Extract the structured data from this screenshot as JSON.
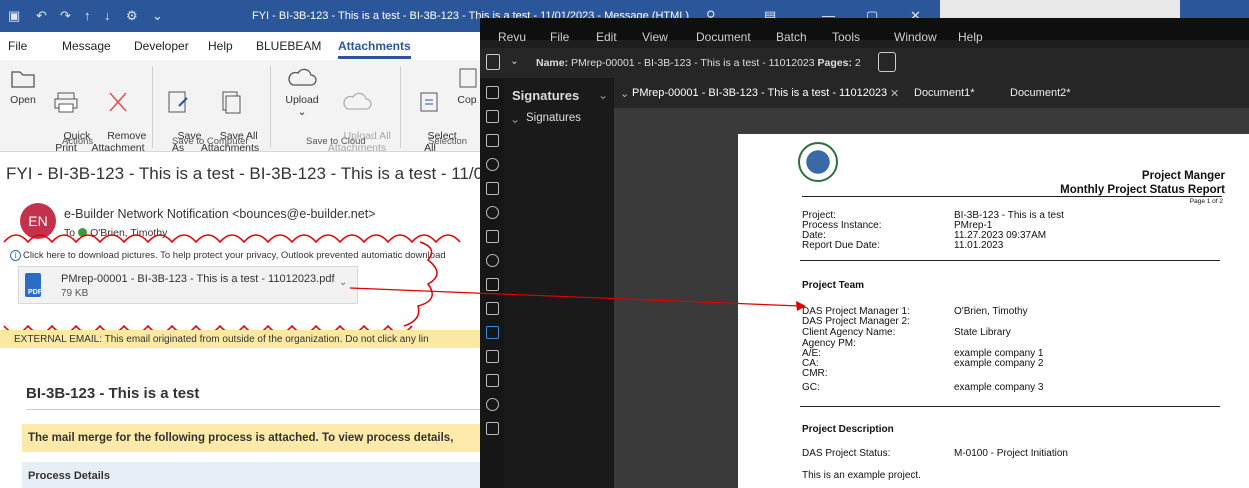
{
  "outlook": {
    "title_bar": {
      "subject_title": "FYI - BI-3B-123 - This is a test - BI-3B-123 - This is a test - 11/01/2023  -  Message (HTML)"
    },
    "menu": {
      "tabs": [
        "File",
        "Message",
        "Developer",
        "Help",
        "BLUEBEAM",
        "Attachments"
      ],
      "active": "Attachments"
    },
    "ribbon": {
      "buttons": {
        "open": "Open",
        "quick_print": "Quick\nPrint",
        "remove": "Remove\nAttachment",
        "save_as": "Save\nAs",
        "save_all": "Save All\nAttachments",
        "upload": "Upload",
        "upload_all": "Upload All\nAttachments",
        "select_all": "Select\nAll",
        "copy": "Cop"
      },
      "groups": {
        "actions": "Actions",
        "save_computer": "Save to Computer",
        "save_cloud": "Save to Cloud",
        "selection": "Selection"
      }
    },
    "message": {
      "subject": "FYI - BI-3B-123 - This is a test - BI-3B-123 - This is a test - 11/0",
      "avatar_initials": "EN",
      "sender": "e-Builder Network Notification <bounces@e-builder.net>",
      "to_label": "To",
      "to_name": "O'Brien, Timothy",
      "download_notice": "Click here to download pictures. To help protect your privacy, Outlook prevented automatic download",
      "attachment_name": "PMrep-00001 - BI-3B-123 - This is a test - 11012023.pdf",
      "attachment_size": "79 KB",
      "pdf_label": "PDF",
      "external_banner": "EXTERNAL EMAIL: This email originated from outside of the organization. Do not click any lin",
      "body_heading": "BI-3B-123 - This is a test",
      "merge_text": "The mail merge for the following process is attached. To view process details,",
      "process_details": "Process Details"
    }
  },
  "bluebeam": {
    "menu": [
      "Revu",
      "File",
      "Edit",
      "View",
      "Document",
      "Batch",
      "Tools",
      "Window",
      "Help"
    ],
    "name_label": "Name:",
    "name_value": "PMrep-00001 - BI-3B-123 - This is a test - 11012023",
    "pages_label": "Pages:",
    "pages_value": "2",
    "panel_title": "Signatures",
    "panel_item": "Signatures",
    "tabs": [
      "PMrep-00001 - BI-3B-123 - This is a test - 11012023",
      "Document1*",
      "Document2*"
    ],
    "document": {
      "title1": "Project Manger",
      "title2": "Monthly Project Status Report",
      "page_of": "Page 1 of 2",
      "fields": [
        {
          "label": "Project:",
          "value": "BI-3B-123 - This is a test"
        },
        {
          "label": "Process Instance:",
          "value": "PMrep-1"
        },
        {
          "label": "Date:",
          "value": "11.27.2023 09:37AM"
        },
        {
          "label": "Report Due Date:",
          "value": "11.01.2023"
        }
      ],
      "team_heading": "Project Team",
      "team": [
        {
          "label": "DAS Project Manager 1:",
          "value": "O'Brien, Timothy"
        },
        {
          "label": "DAS Project Manager 2:",
          "value": ""
        },
        {
          "label": "Client Agency Name:",
          "value": "State Library"
        },
        {
          "label": "Agency PM:",
          "value": ""
        },
        {
          "label": "A/E:",
          "value": "example company 1"
        },
        {
          "label": "CA:",
          "value": "example company 2"
        },
        {
          "label": "CMR:",
          "value": ""
        },
        {
          "label": "GC:",
          "value": "example company 3"
        }
      ],
      "desc_heading": "Project Description",
      "status_label": "DAS Project Status:",
      "status_value": "M-0100 - Project Initiation",
      "description": "This is an example project."
    }
  },
  "colors": {
    "outlook_blue": "#2b579a",
    "annotation_red": "#e00000",
    "banner_yellow": "#fbe9a2"
  }
}
